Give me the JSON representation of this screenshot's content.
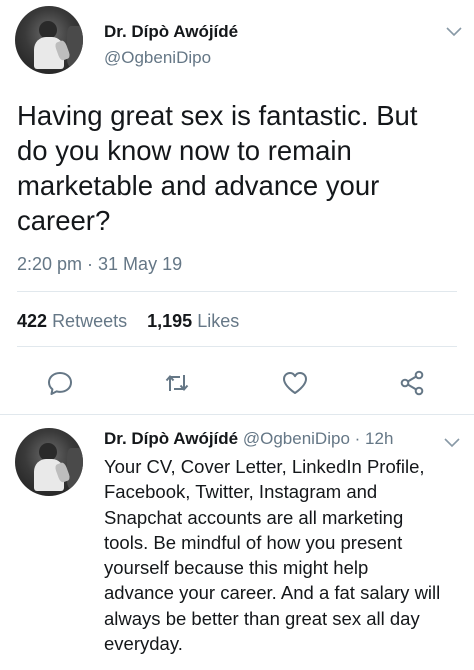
{
  "tweet": {
    "display_name": "Dr. Dípò Awójídé",
    "handle": "@OgbeniDipo",
    "text": "Having great sex is fantastic. But\ndo you know now to remain\nmarketable and advance your\ncareer?",
    "timestamp": "2:20 pm · 31 May 19",
    "retweets_count": "422",
    "retweets_label": "Retweets",
    "likes_count": "1,195",
    "likes_label": "Likes",
    "actions": [
      {
        "name": "reply",
        "icon": "speech-bubble-icon"
      },
      {
        "name": "retweet",
        "icon": "retweet-arrows-icon"
      },
      {
        "name": "like",
        "icon": "heart-icon"
      },
      {
        "name": "share",
        "icon": "share-nodes-icon"
      }
    ]
  },
  "reply": {
    "display_name": "Dr. Dípò Awójídé",
    "handle": "@OgbeniDipo",
    "separator": "·",
    "age": "12h",
    "text": "Your CV, Cover Letter, LinkedIn Profile,\nFacebook, Twitter, Instagram and\nSnapchat accounts are all marketing\ntools. Be mindful of how you present\nyourself because this might help\nadvance your career. And a fat salary will\nalways be better than great sex all day\neveryday."
  },
  "colors": {
    "text_primary": "#14171a",
    "text_secondary": "#657786",
    "divider": "#e1e8ed",
    "icon": "#657786"
  }
}
